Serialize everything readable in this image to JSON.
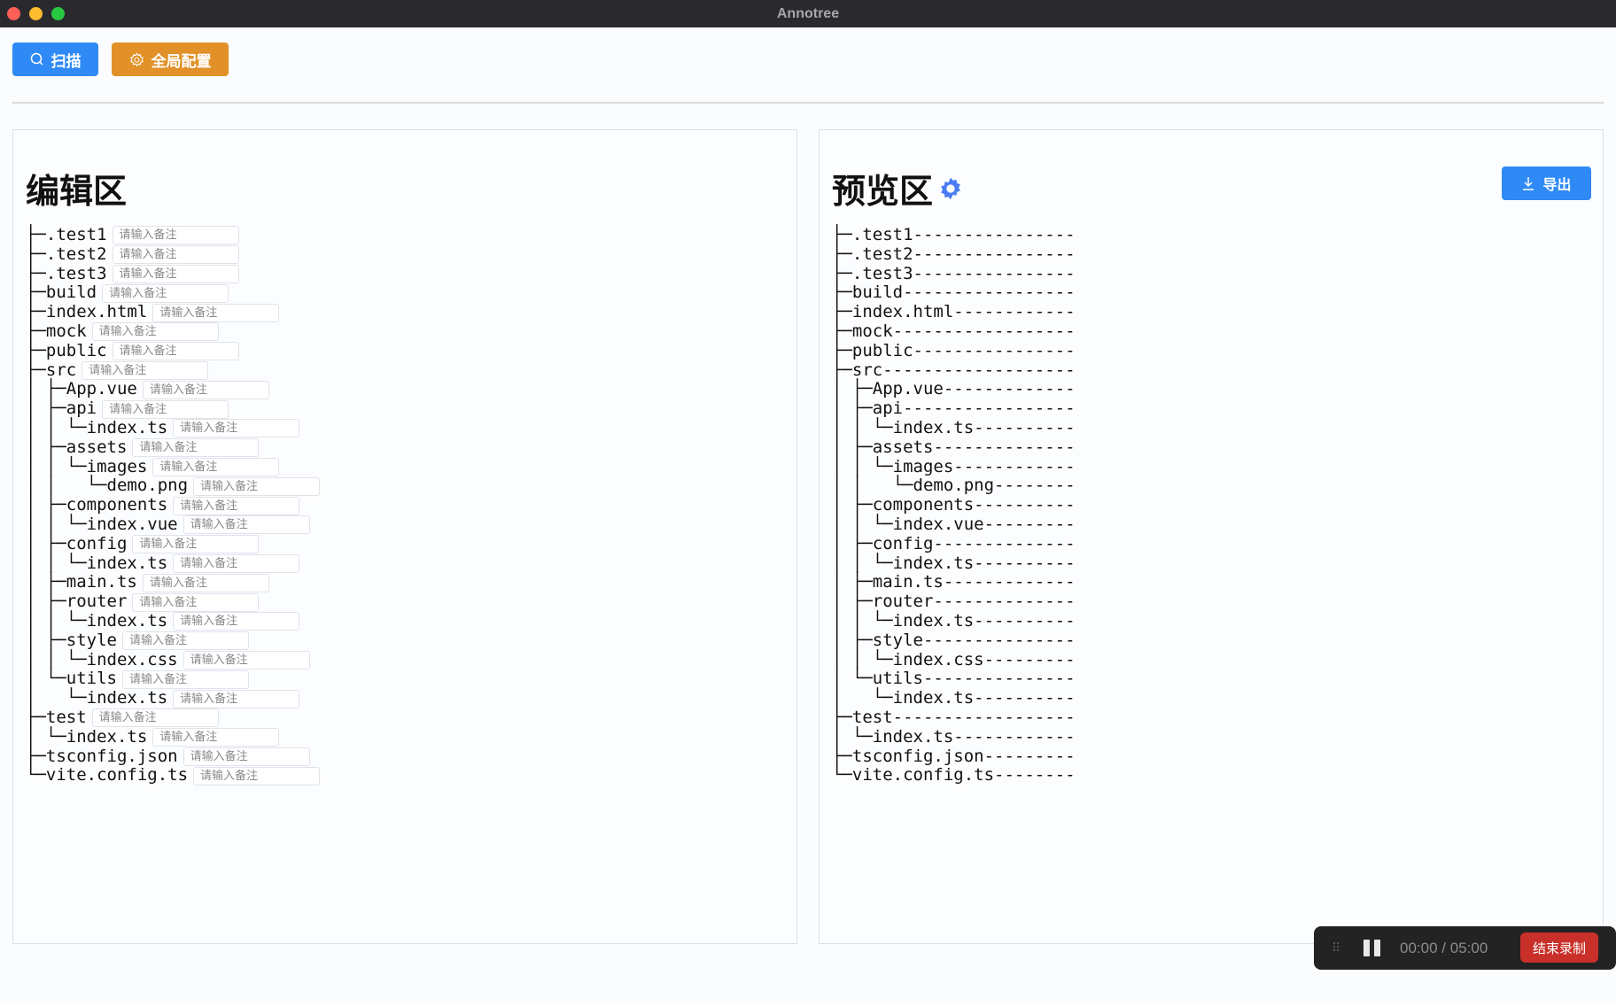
{
  "window": {
    "title": "Annotree"
  },
  "toolbar": {
    "scan_label": "扫描",
    "config_label": "全局配置"
  },
  "editor": {
    "title": "编辑区",
    "placeholder": "请输入备注"
  },
  "preview": {
    "title": "预览区",
    "export_label": "导出",
    "line_length": 24
  },
  "recorder": {
    "elapsed": "00:00",
    "separator": "/",
    "limit": "05:00",
    "stop_label": "结束录制"
  },
  "colors": {
    "primary": "#2f8af5",
    "warning": "#e19128",
    "danger": "#c9302a"
  },
  "tree": [
    {
      "prefix": "├─",
      "name": ".test1"
    },
    {
      "prefix": "├─",
      "name": ".test2"
    },
    {
      "prefix": "├─",
      "name": ".test3"
    },
    {
      "prefix": "├─",
      "name": "build"
    },
    {
      "prefix": "├─",
      "name": "index.html"
    },
    {
      "prefix": "├─",
      "name": "mock"
    },
    {
      "prefix": "├─",
      "name": "public"
    },
    {
      "prefix": "├─",
      "name": "src"
    },
    {
      "prefix": "│ ├─",
      "name": "App.vue"
    },
    {
      "prefix": "│ ├─",
      "name": "api"
    },
    {
      "prefix": "│ │ └─",
      "name": "index.ts"
    },
    {
      "prefix": "│ ├─",
      "name": "assets"
    },
    {
      "prefix": "│ │ └─",
      "name": "images"
    },
    {
      "prefix": "│ │   └─",
      "name": "demo.png"
    },
    {
      "prefix": "│ ├─",
      "name": "components"
    },
    {
      "prefix": "│ │ └─",
      "name": "index.vue"
    },
    {
      "prefix": "│ ├─",
      "name": "config"
    },
    {
      "prefix": "│ │ └─",
      "name": "index.ts"
    },
    {
      "prefix": "│ ├─",
      "name": "main.ts"
    },
    {
      "prefix": "│ ├─",
      "name": "router"
    },
    {
      "prefix": "│ │ └─",
      "name": "index.ts"
    },
    {
      "prefix": "│ ├─",
      "name": "style"
    },
    {
      "prefix": "│ │ └─",
      "name": "index.css"
    },
    {
      "prefix": "│ └─",
      "name": "utils"
    },
    {
      "prefix": "│   └─",
      "name": "index.ts"
    },
    {
      "prefix": "├─",
      "name": "test"
    },
    {
      "prefix": "│ └─",
      "name": "index.ts"
    },
    {
      "prefix": "├─",
      "name": "tsconfig.json"
    },
    {
      "prefix": "└─",
      "name": "vite.config.ts"
    }
  ]
}
